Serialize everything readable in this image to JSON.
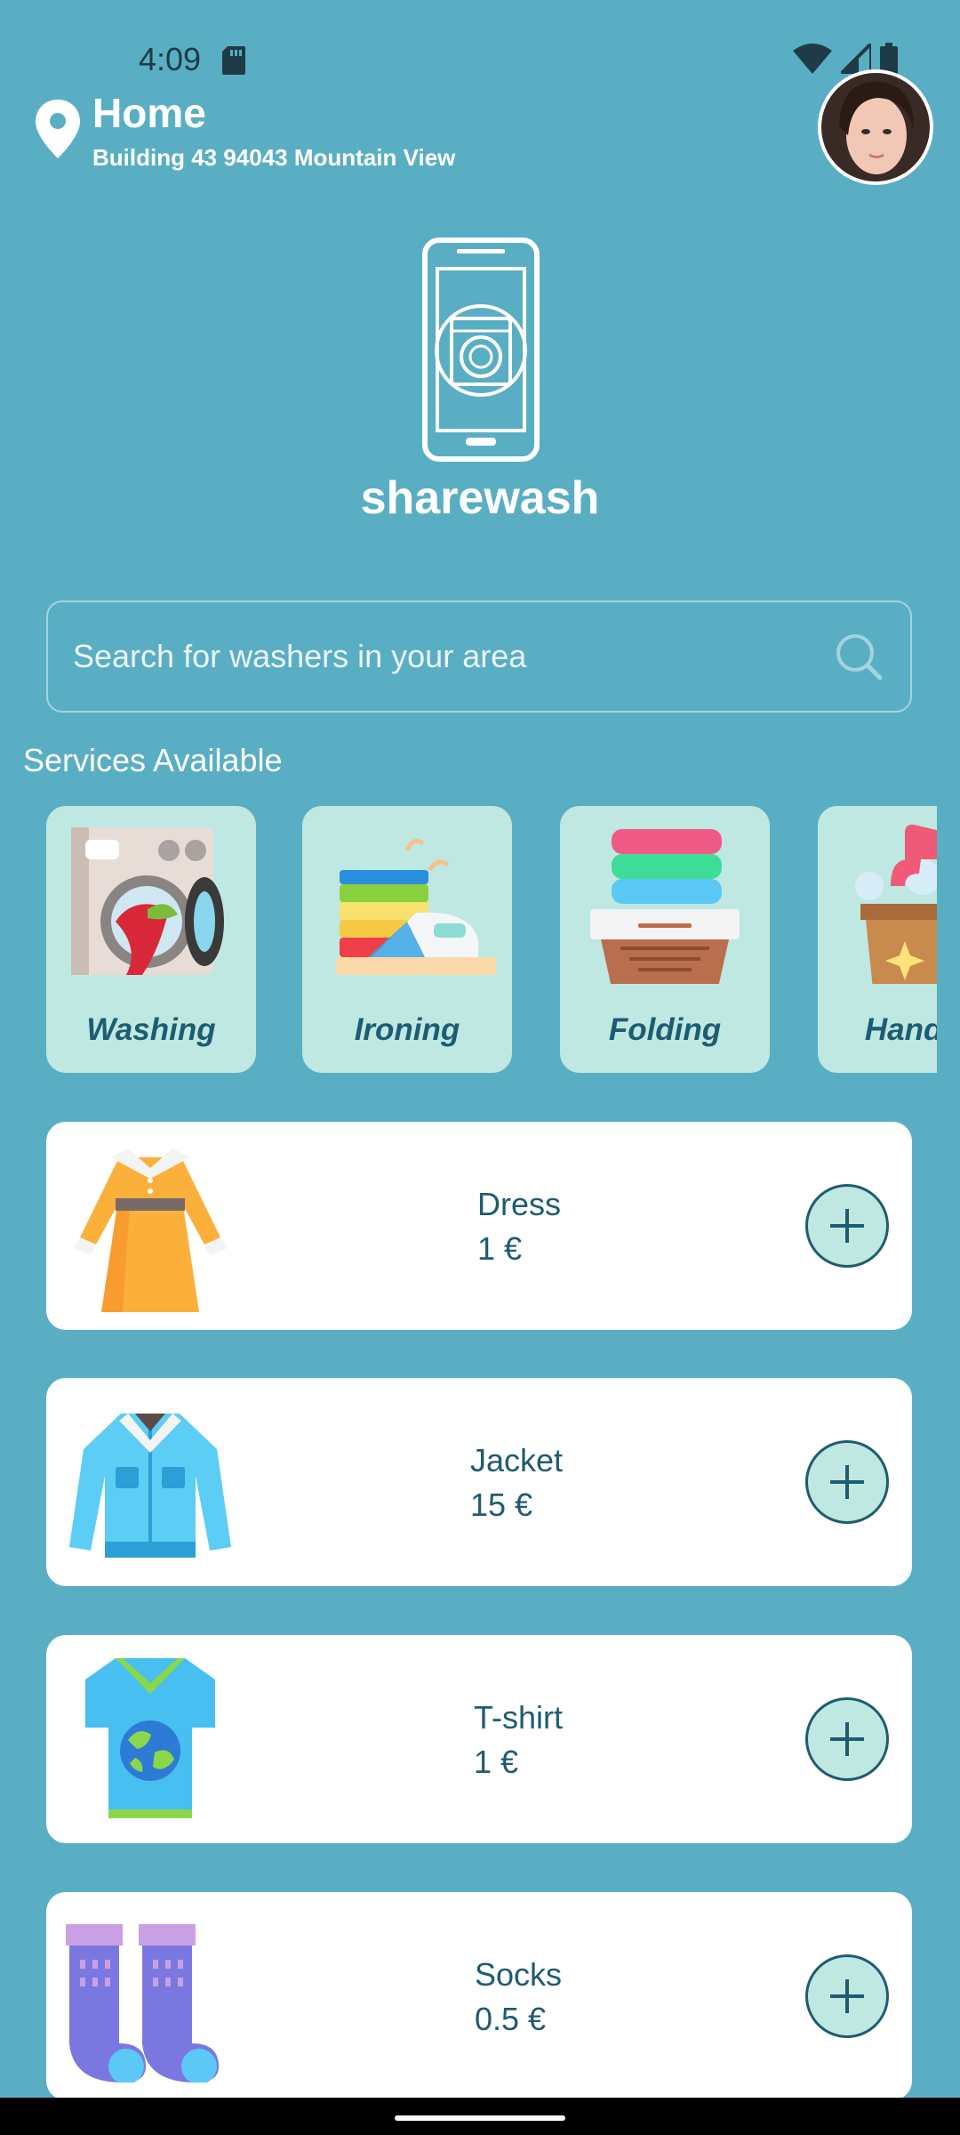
{
  "status_bar": {
    "time": "4:09",
    "icons": [
      "sd-card-icon",
      "wifi-icon",
      "signal-icon",
      "battery-icon"
    ]
  },
  "header": {
    "title": "Home",
    "address": "Building 43 94043 Mountain View"
  },
  "brand": {
    "name": "sharewash"
  },
  "search": {
    "placeholder": "Search for washers in your area"
  },
  "services": {
    "title": "Services Available",
    "items": [
      {
        "label": "Washing"
      },
      {
        "label": "Ironing"
      },
      {
        "label": "Folding"
      },
      {
        "label": "Hand W"
      }
    ]
  },
  "items": [
    {
      "name": "Dress",
      "price": "1 €"
    },
    {
      "name": "Jacket",
      "price": "15 €"
    },
    {
      "name": "T-shirt",
      "price": "1 €"
    },
    {
      "name": "Socks",
      "price": "0.5 €"
    }
  ],
  "colors": {
    "background": "#5aaec3",
    "service_tile": "#bfe8e2",
    "text_dark": "#1e5c72"
  }
}
